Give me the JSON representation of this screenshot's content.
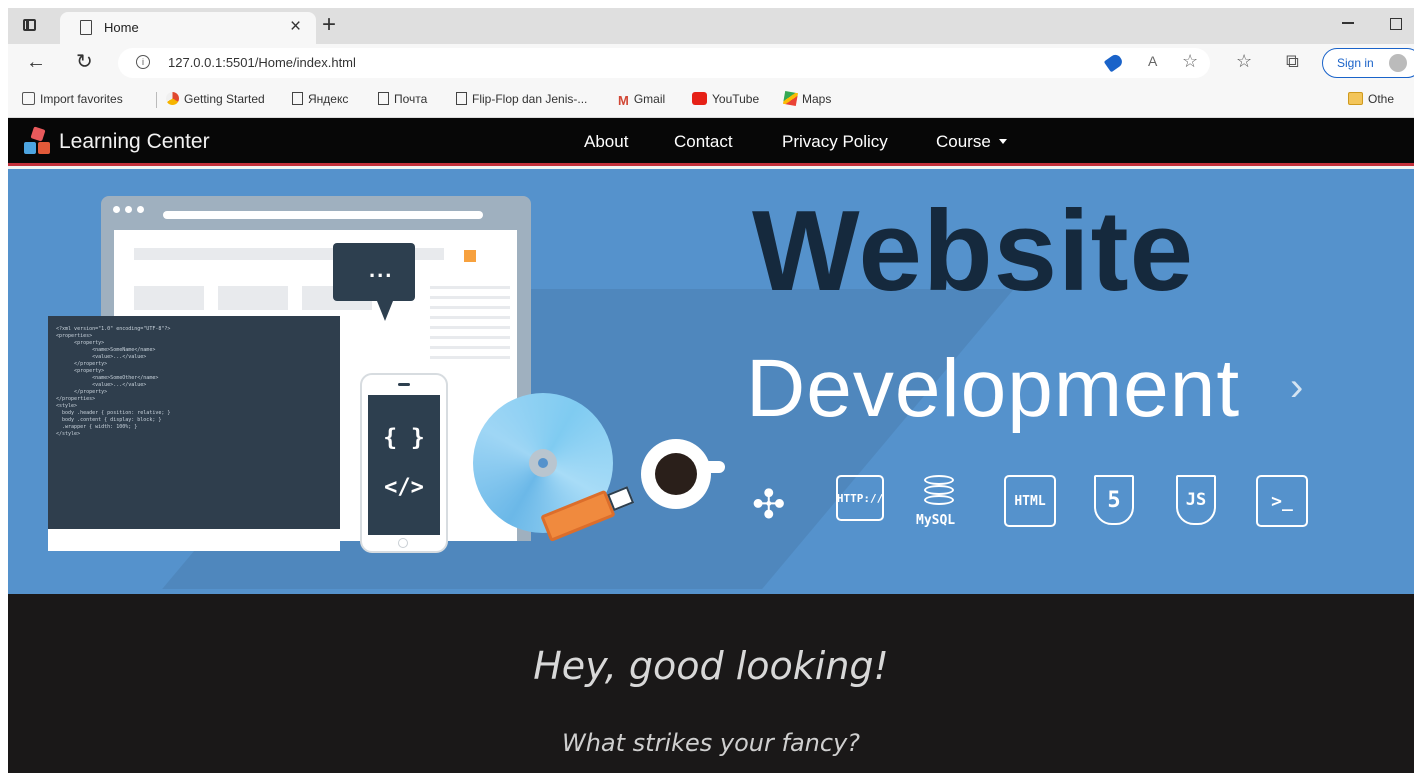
{
  "browser": {
    "tab": {
      "title": "Home"
    },
    "url": "127.0.0.1:5501/Home/index.html",
    "signin_label": "Sign in",
    "bookmarks": [
      {
        "label": "Import favorites",
        "icon": "import-icon"
      },
      {
        "label": "Getting Started",
        "icon": "chrome-icon"
      },
      {
        "label": "Яндекс",
        "icon": "page-icon"
      },
      {
        "label": "Почта",
        "icon": "page-icon"
      },
      {
        "label": "Flip-Flop dan Jenis-...",
        "icon": "page-icon"
      },
      {
        "label": "Gmail",
        "icon": "gmail-icon"
      },
      {
        "label": "YouTube",
        "icon": "youtube-icon"
      },
      {
        "label": "Maps",
        "icon": "maps-icon"
      }
    ],
    "other_folder": "Othe"
  },
  "site": {
    "brand": "Learning Center",
    "nav": [
      {
        "label": "About"
      },
      {
        "label": "Contact"
      },
      {
        "label": "Privacy Policy"
      },
      {
        "label": "Course"
      }
    ],
    "hero": {
      "title_line1": "Website",
      "title_line2": "Development",
      "code_lines": [
        "<?xml version=\"1.0\" encoding=\"UTF-8\"?>",
        "<properties>",
        "      <property>",
        "            <name>SomeName</name>",
        "            <value>...</value>",
        "      </property>",
        "      <property>",
        "            <name>SomeOther</name>",
        "            <value>...</value>",
        "      </property>",
        "</properties>",
        "",
        "<style>",
        "  body .header { position: relative; }",
        "  body .content { display: block; }",
        "  .wrapper { width: 100%; }",
        "</style>"
      ],
      "phone_glyph_top": "{ }",
      "phone_glyph_bottom": "</>",
      "tech_icons": {
        "http": "HTTP://",
        "mysql": "MySQL",
        "html": "HTML",
        "html5": "5",
        "js": "JS",
        "terminal": ">_"
      }
    },
    "tagline": "Hey, good looking!",
    "subline": "What strikes your fancy?"
  }
}
